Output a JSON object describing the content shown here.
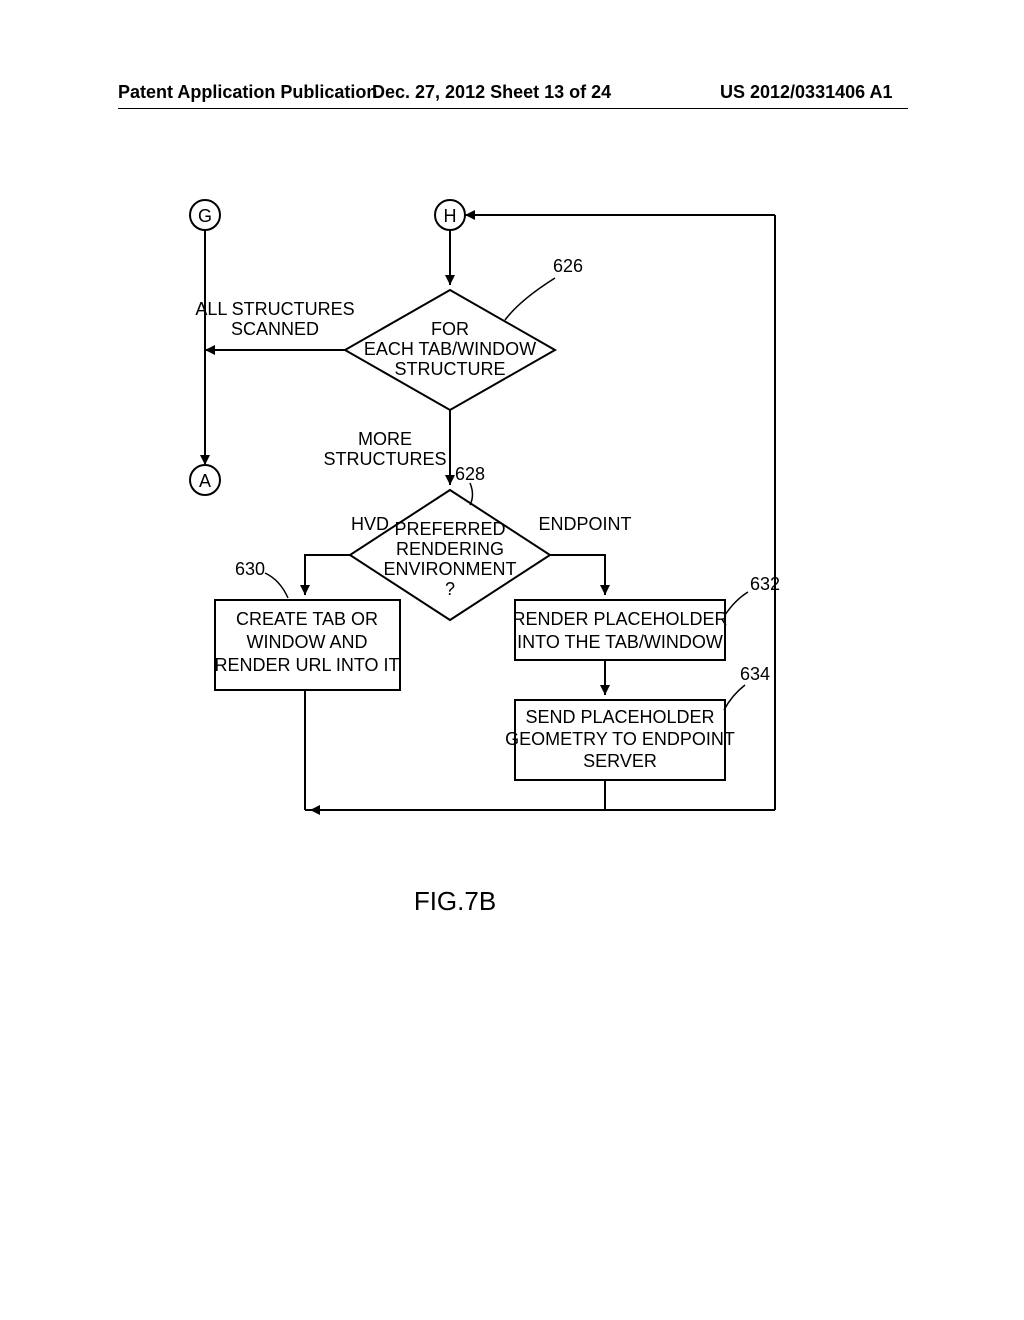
{
  "header": {
    "left": "Patent Application Publication",
    "mid": "Dec. 27, 2012   Sheet 13 of 24",
    "right": "US 2012/0331406 A1"
  },
  "connectors": {
    "G": "G",
    "H": "H",
    "A": "A"
  },
  "decision626": {
    "l1": "FOR",
    "l2": "EACH TAB/WINDOW",
    "l3": "STRUCTURE"
  },
  "labels626": {
    "left_top": "ALL STRUCTURES",
    "left_bottom": "SCANNED",
    "more_top": "MORE",
    "more_bottom": "STRUCTURES"
  },
  "decision628": {
    "l1": "PREFERRED",
    "l2": "RENDERING",
    "l3": "ENVIRONMENT",
    "l4": "?"
  },
  "labels628": {
    "left": "HVD",
    "right": "ENDPOINT"
  },
  "box630": {
    "l1": "CREATE TAB OR",
    "l2": "WINDOW AND",
    "l3": "RENDER URL INTO IT"
  },
  "box632": {
    "l1": "RENDER PLACEHOLDER",
    "l2": "INTO THE TAB/WINDOW"
  },
  "box634": {
    "l1": "SEND PLACEHOLDER",
    "l2": "GEOMETRY TO ENDPOINT",
    "l3": "SERVER"
  },
  "refs": {
    "r626": "626",
    "r628": "628",
    "r630": "630",
    "r632": "632",
    "r634": "634"
  },
  "figure": "FIG.7B"
}
